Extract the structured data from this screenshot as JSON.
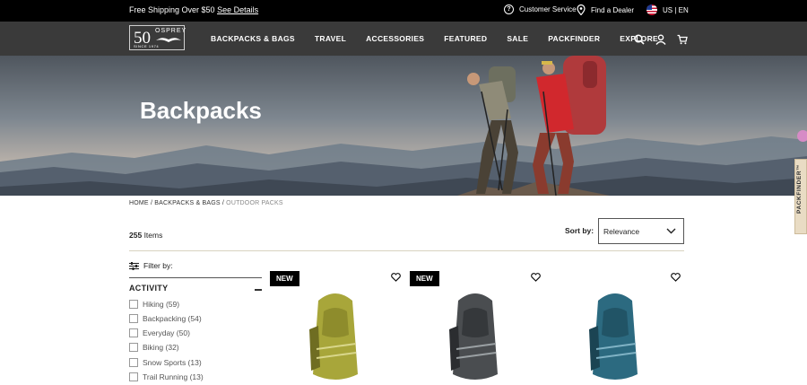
{
  "topbar": {
    "shipping_text": "Free Shipping Over $50",
    "shipping_link": "See Details",
    "customer_service": "Customer Service",
    "find_dealer": "Find a Dealer",
    "locale": "US | EN"
  },
  "logo": {
    "number": "50",
    "brand": "OSPREY",
    "since": "SINCE 1974"
  },
  "nav": {
    "items": [
      "BACKPACKS & BAGS",
      "TRAVEL",
      "ACCESSORIES",
      "FEATURED",
      "SALE",
      "PACKFINDER",
      "EXPLORE"
    ]
  },
  "hero": {
    "title": "Backpacks"
  },
  "side_tab": {
    "label": "PACKFINDER™"
  },
  "breadcrumb": {
    "home": "HOME",
    "section": "BACKPACKS & BAGS",
    "current": "OUTDOOR PACKS"
  },
  "results": {
    "count": "255",
    "label": "Items"
  },
  "sort": {
    "label": "Sort by:",
    "value": "Relevance"
  },
  "filters": {
    "title": "Filter by:",
    "section": "ACTIVITY",
    "options": [
      "Hiking (59)",
      "Backpacking (54)",
      "Everyday (50)",
      "Biking (32)",
      "Snow Sports (13)",
      "Trail Running (13)"
    ]
  },
  "products": [
    {
      "badge": "NEW",
      "color": "#a8a63a"
    },
    {
      "badge": "NEW",
      "color": "#4a4d50"
    },
    {
      "badge": "",
      "color": "#2c6a80"
    }
  ]
}
